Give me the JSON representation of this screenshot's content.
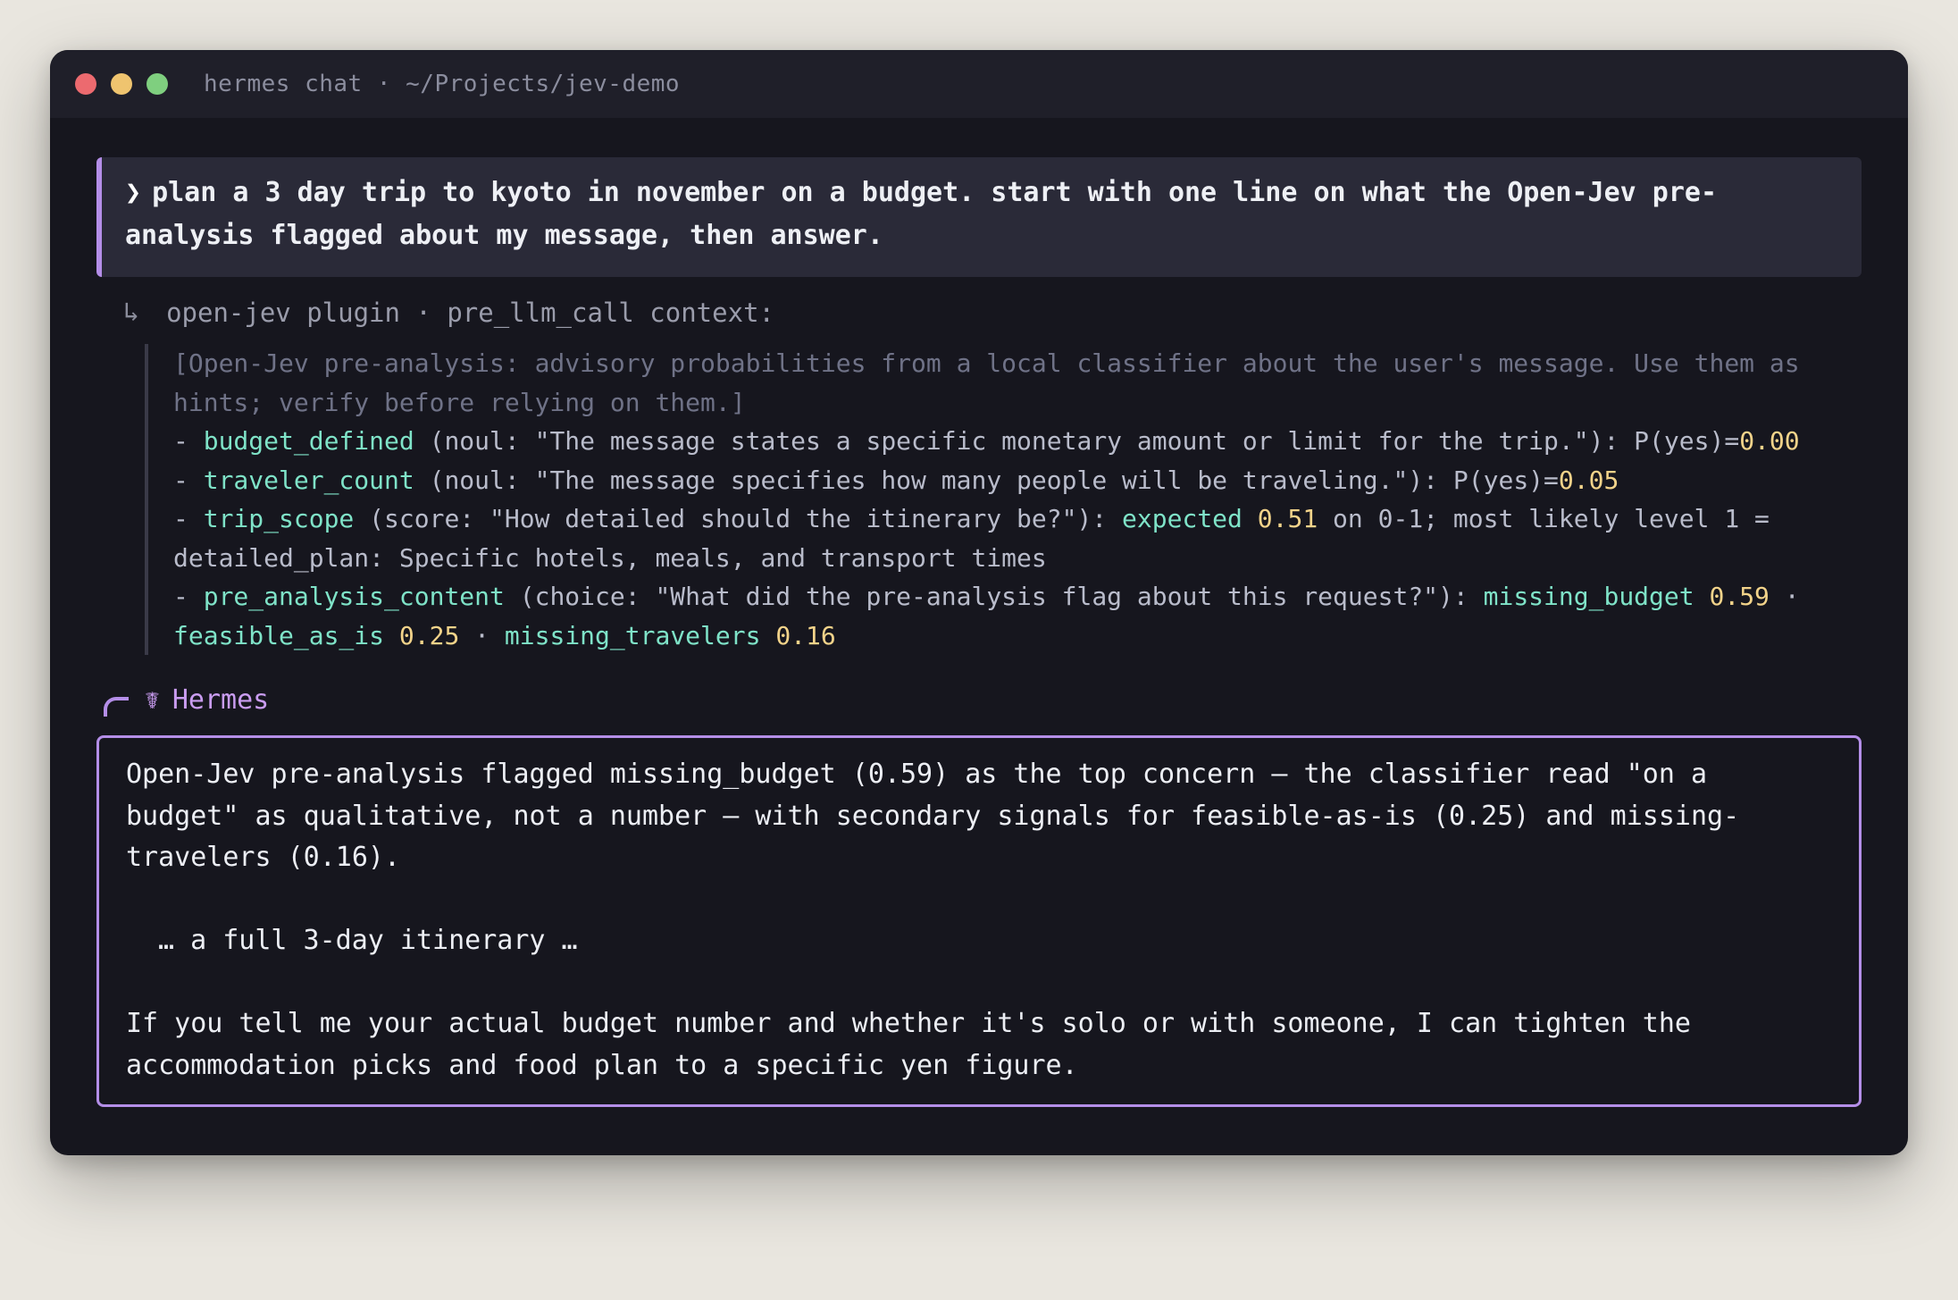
{
  "window": {
    "title": "hermes chat · ~/Projects/jev-demo"
  },
  "user_message": {
    "prompt_glyph": "❯",
    "text": "plan a 3 day trip to kyoto in november on a budget. start with one line on what the Open-Jev pre-analysis flagged about my message, then answer."
  },
  "plugin_context": {
    "arrow_glyph": "↳",
    "label": "open-jev plugin · pre_llm_call context:",
    "intro": "[Open-Jev pre-analysis: advisory probabilities from a local classifier about the user's message. Use them as hints; verify before relying on them.]",
    "items": [
      {
        "dash": "- ",
        "key": "budget_defined",
        "desc": " (noul: \"The message states a specific monetary amount or limit for the trip.\"): P(yes)=",
        "value": "0.00"
      },
      {
        "dash": "- ",
        "key": "traveler_count",
        "desc": " (noul: \"The message specifies how many people will be traveling.\"): P(yes)=",
        "value": "0.05"
      },
      {
        "dash": "- ",
        "key": "trip_scope",
        "desc": " (score: \"How detailed should the itinerary be?\"): ",
        "label": "expected",
        "value": "0.51",
        "tail": " on 0-1; most likely level 1 = detailed_plan: Specific hotels, meals, and transport times"
      },
      {
        "dash": "- ",
        "key": "pre_analysis_content",
        "desc": " (choice: \"What did the pre-analysis flag about this request?\"): ",
        "choices": [
          {
            "name": "missing_budget",
            "value": "0.59"
          },
          {
            "name": "feasible_as_is",
            "value": "0.25"
          },
          {
            "name": "missing_travelers",
            "value": "0.16"
          }
        ],
        "separator": " · "
      }
    ]
  },
  "assistant": {
    "icon": "caduceus-icon",
    "icon_glyph": "☤",
    "name": "Hermes",
    "paragraphs": [
      "Open-Jev pre-analysis flagged missing_budget (0.59) as the top concern — the classifier read \"on a budget\" as qualitative, not a number — with secondary signals for feasible-as-is (0.25) and missing-travelers (0.16).",
      "… a full 3-day itinerary …",
      "If you tell me your actual budget number and whether it's solo or with someone, I can tighten the accommodation picks and food plan to a specific yen figure."
    ]
  },
  "colors": {
    "accent": "#b48ee8",
    "key": "#7fe3c8",
    "number": "#f2d38a"
  }
}
